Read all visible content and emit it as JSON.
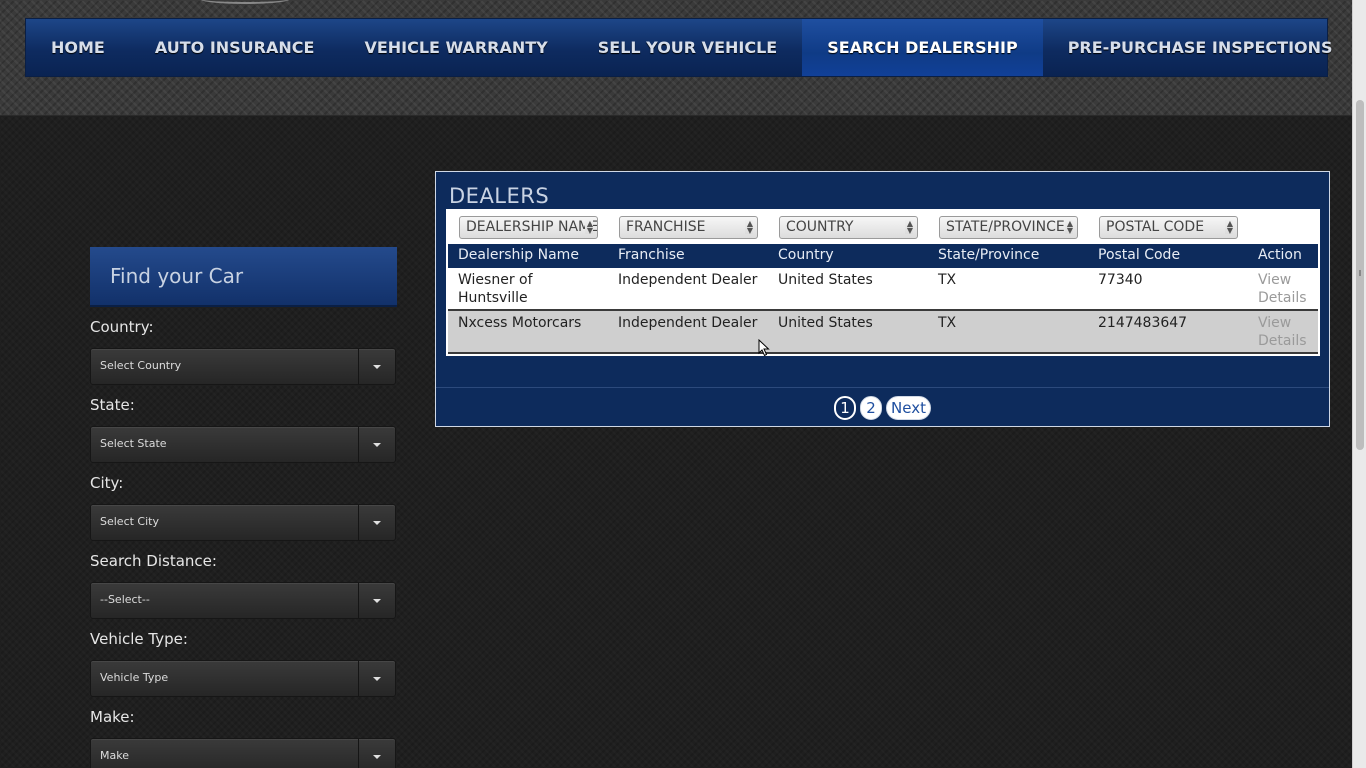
{
  "nav": {
    "items": [
      {
        "label": "HOME"
      },
      {
        "label": "AUTO INSURANCE"
      },
      {
        "label": "VEHICLE WARRANTY"
      },
      {
        "label": "SELL YOUR VEHICLE"
      },
      {
        "label": "SEARCH DEALERSHIP"
      },
      {
        "label": "PRE-PURCHASE INSPECTIONS"
      }
    ],
    "active": "SEARCH DEALERSHIP"
  },
  "sidebar": {
    "title": "Find your Car",
    "fields": [
      {
        "label": "Country:",
        "value": "Select Country"
      },
      {
        "label": "State:",
        "value": "Select State"
      },
      {
        "label": "City:",
        "value": "Select City"
      },
      {
        "label": "Search Distance:",
        "value": "--Select--"
      },
      {
        "label": "Vehicle Type:",
        "value": "Vehicle Type"
      },
      {
        "label": "Make:",
        "value": "Make"
      }
    ]
  },
  "dealers": {
    "title": "DEALERS",
    "filters": [
      "DEALERSHIP NAME",
      "FRANCHISE",
      "COUNTRY",
      "STATE/PROVINCE",
      "POSTAL CODE"
    ],
    "columns": [
      "Dealership Name",
      "Franchise",
      "Country",
      "State/Province",
      "Postal Code",
      "Action"
    ],
    "rows": [
      {
        "name_line1": "Wiesner of",
        "name_line2": "Huntsville",
        "franchise": "Independent Dealer",
        "country": "United States",
        "state": "TX",
        "postal": "77340",
        "action_line1": "View",
        "action_line2": "Details"
      },
      {
        "name_line1": "Nxcess Motorcars",
        "name_line2": "",
        "franchise": "Independent Dealer",
        "country": "United States",
        "state": "TX",
        "postal": "2147483647",
        "action_line1": "View",
        "action_line2": "Details"
      }
    ],
    "pagination": {
      "pages": [
        "1",
        "2"
      ],
      "current": "1",
      "next_label": "Next"
    }
  },
  "colors": {
    "nav_blue": "#0e2b60",
    "nav_active": "#0f3b86",
    "panel_blue": "#0d2b5c",
    "row_alt": "#cfcfcf"
  }
}
